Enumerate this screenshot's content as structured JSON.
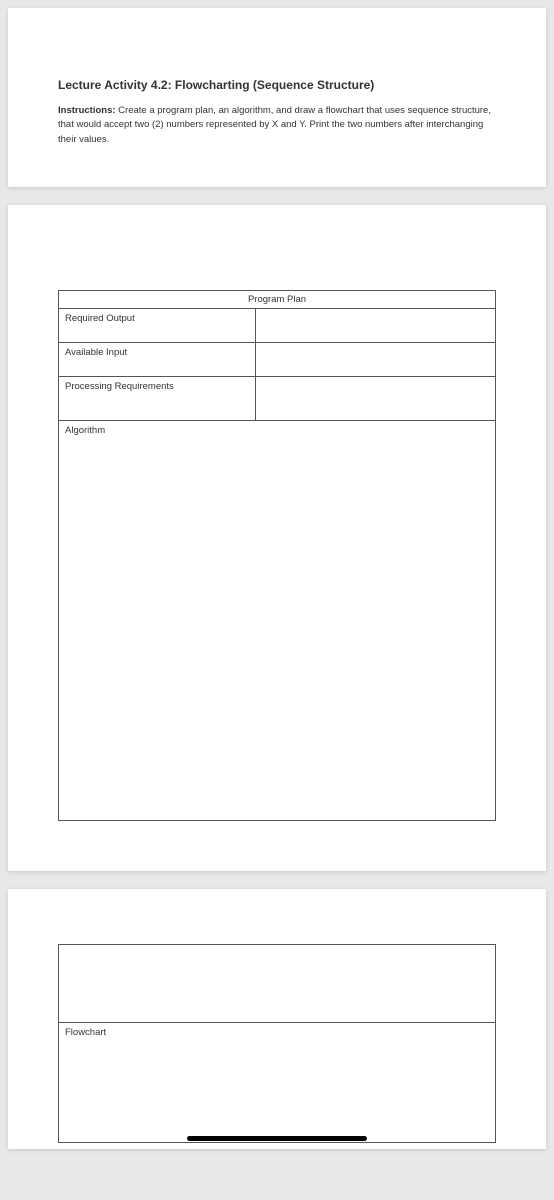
{
  "header": {
    "title": "Lecture Activity 4.2: Flowcharting (Sequence Structure)",
    "instructions_label": "Instructions:",
    "instructions_text": " Create a program plan, an algorithm, and draw a flowchart that uses sequence structure, that would accept two (2) numbers represented by X and Y. Print the two numbers after interchanging their values."
  },
  "plan_table": {
    "header": "Program Plan",
    "rows": {
      "required_output": "Required Output",
      "available_input": "Available Input",
      "processing_requirements": "Processing Requirements",
      "algorithm": "Algorithm"
    }
  },
  "flowchart_table": {
    "label": "Flowchart"
  }
}
